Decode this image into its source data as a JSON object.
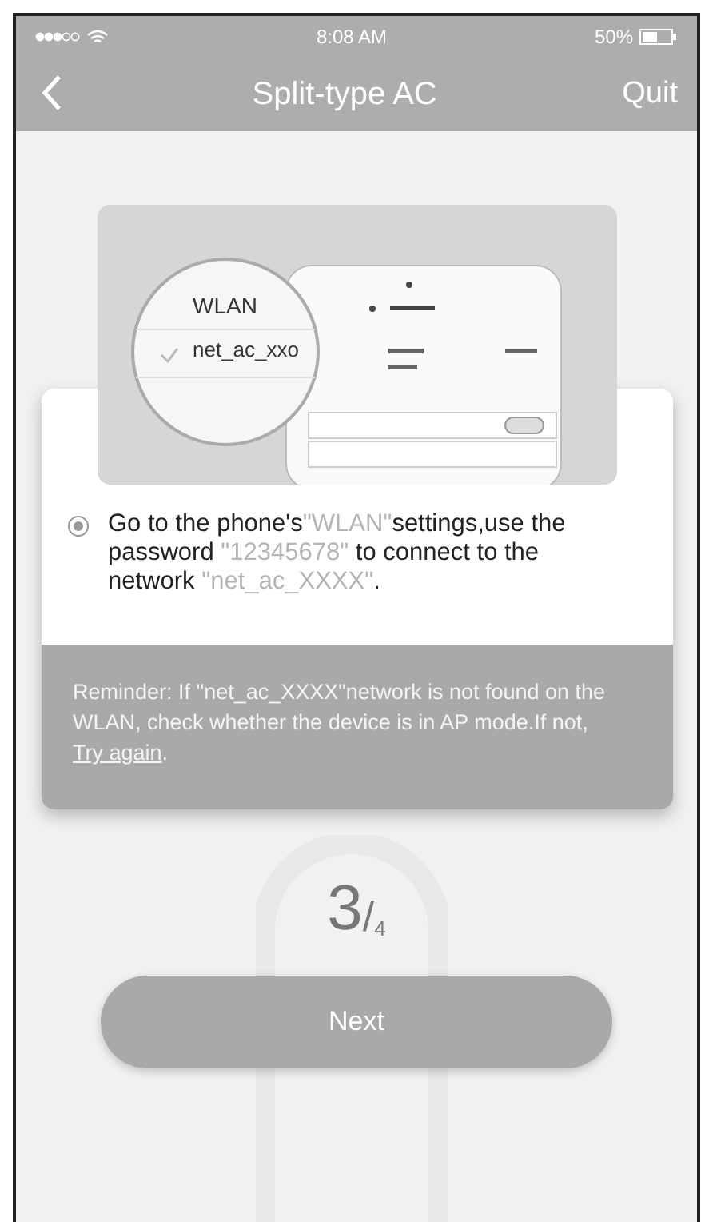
{
  "status_bar": {
    "time": "8:08 AM",
    "battery": "50%"
  },
  "nav": {
    "title": "Split-type AC",
    "action": "Quit"
  },
  "illustration": {
    "magnifier_title": "WLAN",
    "magnifier_network": "net_ac_xxo"
  },
  "instruction": {
    "selected": true,
    "segments": [
      {
        "kind": "plain",
        "text": "Go to the phone's"
      },
      {
        "kind": "highlight",
        "text": "\"WLAN\""
      },
      {
        "kind": "plain",
        "text": "settings,use the password "
      },
      {
        "kind": "highlight",
        "text": "\"12345678\""
      },
      {
        "kind": "plain",
        "text": " to connect to the network "
      },
      {
        "kind": "highlight",
        "text": "\"net_ac_XXXX\""
      },
      {
        "kind": "plain",
        "text": "."
      }
    ]
  },
  "reminder": {
    "text": "Reminder: If \"net_ac_XXXX\"network is not found on the WLAN, check whether the device is in AP mode.If not, ",
    "link": "Try again",
    "after": "."
  },
  "step": {
    "current": "3",
    "separator": "/",
    "total": "4"
  },
  "buttons": [
    {
      "label": "Next"
    }
  ]
}
